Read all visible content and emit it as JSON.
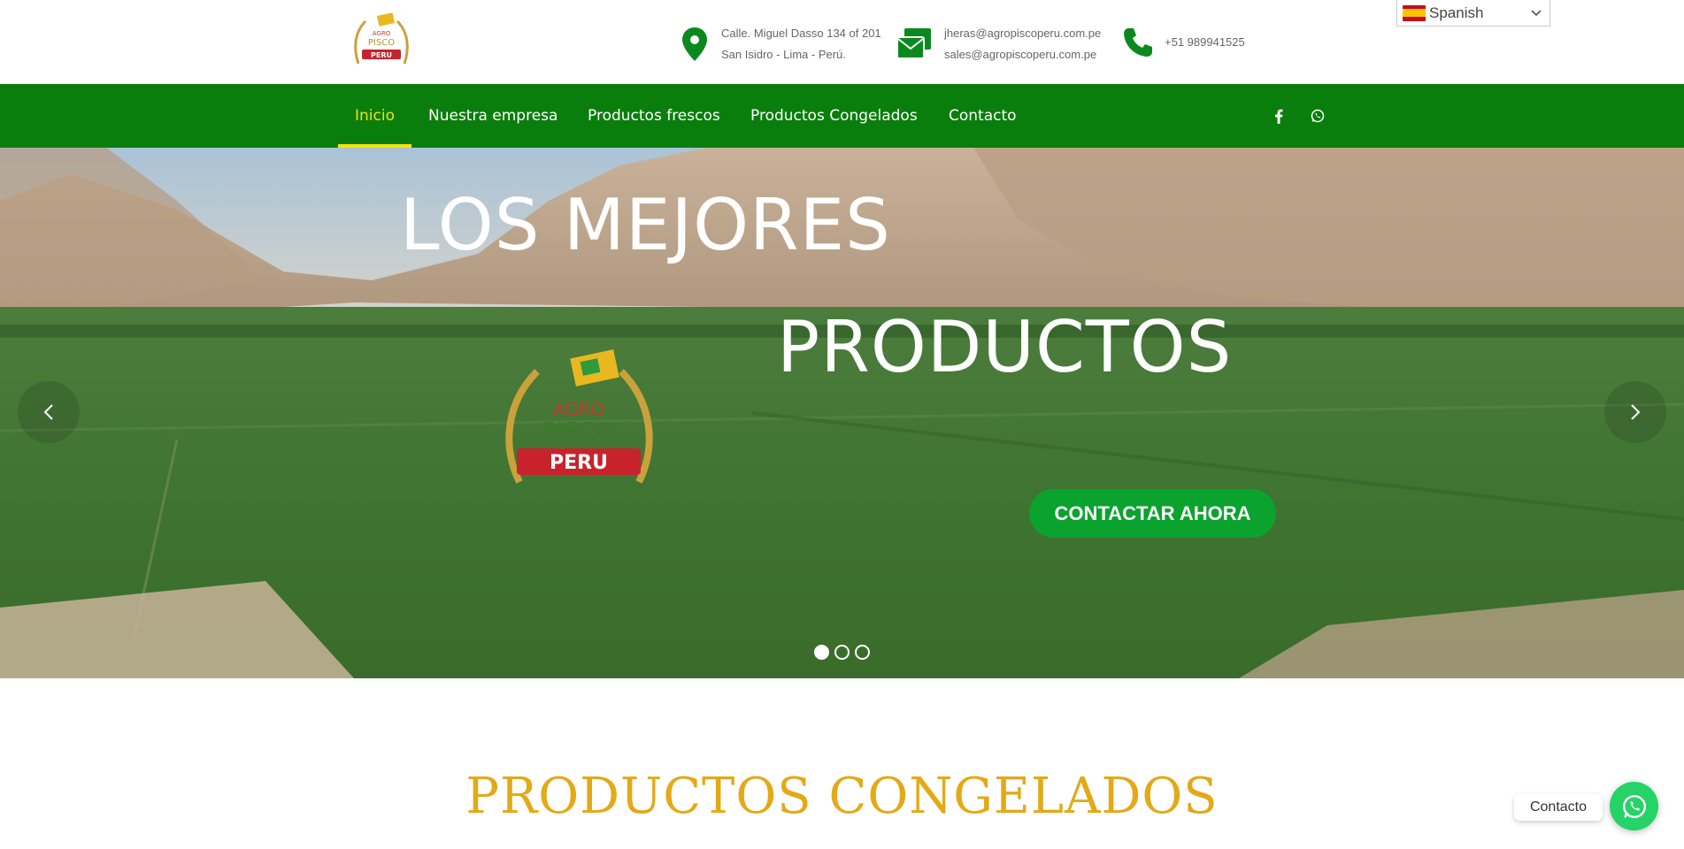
{
  "header": {
    "address_line1": "Calle. Miguel Dasso 134 of 201",
    "address_line2": "San Isidro - Lima - Perú.",
    "email1": "jheras@agropiscoperu.com.pe",
    "email2": "sales@agropiscoperu.com.pe",
    "phone": "+51 989941525",
    "language": "Spanish",
    "logo_text": {
      "top": "AGRO",
      "middle": "PISCO",
      "bottom": "PERU"
    }
  },
  "nav": {
    "items": [
      {
        "label": "Inicio",
        "active": true
      },
      {
        "label": "Nuestra empresa",
        "active": false
      },
      {
        "label": "Productos frescos",
        "active": false
      },
      {
        "label": "Productos Congelados",
        "active": false
      },
      {
        "label": "Contacto",
        "active": false
      }
    ],
    "social": [
      "facebook-icon",
      "whatsapp-icon"
    ]
  },
  "hero": {
    "title_line1": "LOS MEJORES",
    "title_line2": "PRODUCTOS",
    "cta_label": "CONTACTAR AHORA",
    "slides_count": 3,
    "active_slide": 1
  },
  "section": {
    "title": "PRODUCTOS CONGELADOS"
  },
  "whatsapp_widget": {
    "label": "Contacto"
  },
  "colors": {
    "nav_bg": "#0a7e0c",
    "nav_active": "#f4e20a",
    "cta_bg": "#0aa32e",
    "section_title": "#e3a917",
    "icon_green": "#0a8a1e",
    "whatsapp": "#25d366"
  }
}
